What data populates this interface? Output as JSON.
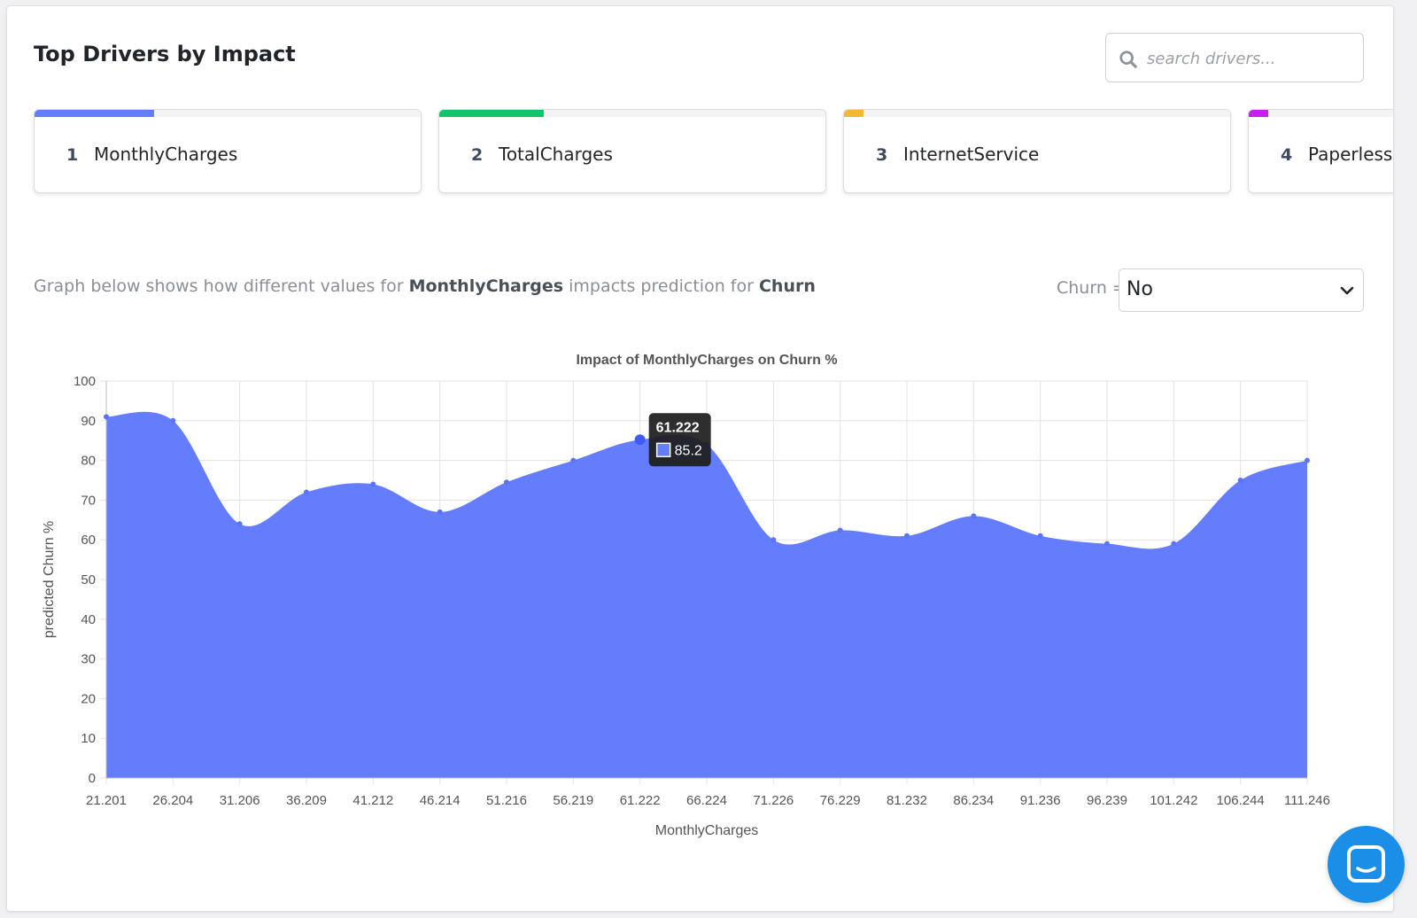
{
  "header": {
    "title": "Top Drivers by Impact",
    "search_placeholder": "search drivers...",
    "search_icon": "search-icon"
  },
  "drivers": [
    {
      "rank": "1",
      "name": "MonthlyCharges",
      "impact_fraction": 0.31,
      "color": "#647dfc"
    },
    {
      "rank": "2",
      "name": "TotalCharges",
      "impact_fraction": 0.27,
      "color": "#13c46a"
    },
    {
      "rank": "3",
      "name": "InternetService",
      "impact_fraction": 0.05,
      "color": "#f5b731"
    },
    {
      "rank": "4",
      "name": "PaperlessBilling",
      "impact_fraction": 0.05,
      "color": "#c81ef2"
    }
  ],
  "description": {
    "prefix": "Graph below shows how different values for",
    "feature": "MonthlyCharges",
    "middle": "impacts prediction for",
    "target": "Churn"
  },
  "class_selector": {
    "label": "Churn =",
    "value": "No",
    "chevron_icon": "chevron-down-icon"
  },
  "chart_data": {
    "type": "area",
    "title": "Impact of MonthlyCharges on Churn %",
    "xlabel": "MonthlyCharges",
    "ylabel": "predicted Churn %",
    "x": [
      "21.201",
      "26.204",
      "31.206",
      "36.209",
      "41.212",
      "46.214",
      "51.216",
      "56.219",
      "61.222",
      "66.224",
      "71.226",
      "76.229",
      "81.232",
      "86.234",
      "91.236",
      "96.239",
      "101.242",
      "106.244",
      "111.246"
    ],
    "values": [
      91,
      90,
      64,
      72,
      74,
      67,
      74.5,
      80,
      85.2,
      84,
      60,
      62.4,
      61,
      66,
      61,
      59,
      59,
      75,
      80
    ],
    "ylim": [
      0,
      100
    ],
    "yticks": [
      "0",
      "10",
      "20",
      "30",
      "40",
      "50",
      "60",
      "70",
      "80",
      "90",
      "100"
    ],
    "grid": true,
    "color": "#647dfc",
    "tooltip": {
      "index": 8,
      "title": "61.222",
      "value": "85.2"
    }
  },
  "chat_widget": {
    "icon": "chat-bubble-icon",
    "color": "#1b8ee8"
  }
}
